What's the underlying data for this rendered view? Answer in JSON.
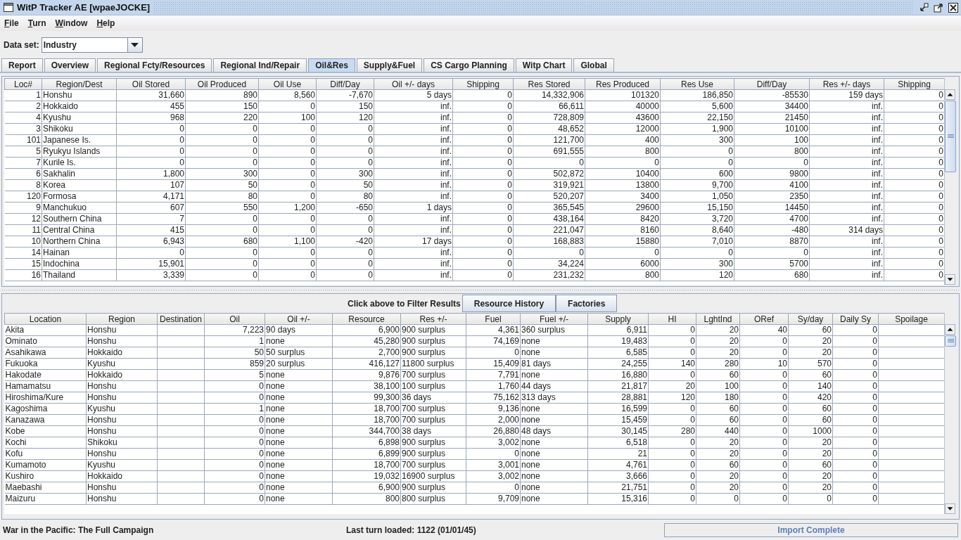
{
  "window": {
    "title": "WitP Tracker AE [wpaeJOCKE]"
  },
  "menu": [
    "File",
    "Turn",
    "Window",
    "Help"
  ],
  "dataset": {
    "label": "Data set:",
    "value": "Industry"
  },
  "tabs": [
    {
      "label": "Report",
      "selected": false
    },
    {
      "label": "Overview",
      "selected": false
    },
    {
      "label": "Regional Fcty/Resources",
      "selected": false
    },
    {
      "label": "Regional Ind/Repair",
      "selected": false
    },
    {
      "label": "Oil&Res",
      "selected": true
    },
    {
      "label": "Supply&Fuel",
      "selected": false
    },
    {
      "label": "CS Cargo Planning",
      "selected": false
    },
    {
      "label": "Witp Chart",
      "selected": false
    },
    {
      "label": "Global",
      "selected": false
    }
  ],
  "oil_res_table": {
    "columns": [
      {
        "label": "Loc#",
        "kind": "number"
      },
      {
        "label": "Region/Dest",
        "kind": "text"
      },
      {
        "label": "Oil Stored",
        "kind": "number"
      },
      {
        "label": "Oil Produced",
        "kind": "number"
      },
      {
        "label": "Oil Use",
        "kind": "number"
      },
      {
        "label": "Diff/Day",
        "kind": "number"
      },
      {
        "label": "Oil +/- days",
        "kind": "number"
      },
      {
        "label": "Shipping",
        "kind": "number"
      },
      {
        "label": "Res Stored",
        "kind": "number"
      },
      {
        "label": "Res Produced",
        "kind": "number"
      },
      {
        "label": "Res Use",
        "kind": "number"
      },
      {
        "label": "Diff/Day",
        "kind": "number"
      },
      {
        "label": "Res +/- days",
        "kind": "number"
      },
      {
        "label": "Shipping",
        "kind": "number"
      }
    ],
    "rows": [
      [
        "1",
        "Honshu",
        "31,660",
        "890",
        "8,560",
        "-7,670",
        "5 days",
        "0",
        "14,332,906",
        "101320",
        "186,850",
        "-85530",
        "159 days",
        "0"
      ],
      [
        "2",
        "Hokkaido",
        "455",
        "150",
        "0",
        "150",
        "inf.",
        "0",
        "66,611",
        "40000",
        "5,600",
        "34400",
        "inf.",
        "0"
      ],
      [
        "4",
        "Kyushu",
        "968",
        "220",
        "100",
        "120",
        "inf.",
        "0",
        "728,809",
        "43600",
        "22,150",
        "21450",
        "inf.",
        "0"
      ],
      [
        "3",
        "Shikoku",
        "0",
        "0",
        "0",
        "0",
        "inf.",
        "0",
        "48,652",
        "12000",
        "1,900",
        "10100",
        "inf.",
        "0"
      ],
      [
        "101",
        "Japanese Is.",
        "0",
        "0",
        "0",
        "0",
        "inf.",
        "0",
        "121,700",
        "400",
        "300",
        "100",
        "inf.",
        "0"
      ],
      [
        "5",
        "Ryukyu Islands",
        "0",
        "0",
        "0",
        "0",
        "inf.",
        "0",
        "691,555",
        "800",
        "0",
        "800",
        "inf.",
        "0"
      ],
      [
        "7",
        "Kurile Is.",
        "0",
        "0",
        "0",
        "0",
        "inf.",
        "0",
        "0",
        "0",
        "0",
        "0",
        "inf.",
        "0"
      ],
      [
        "6",
        "Sakhalin",
        "1,800",
        "300",
        "0",
        "300",
        "inf.",
        "0",
        "502,872",
        "10400",
        "600",
        "9800",
        "inf.",
        "0"
      ],
      [
        "8",
        "Korea",
        "107",
        "50",
        "0",
        "50",
        "inf.",
        "0",
        "319,921",
        "13800",
        "9,700",
        "4100",
        "inf.",
        "0"
      ],
      [
        "120",
        "Formosa",
        "4,171",
        "80",
        "0",
        "80",
        "inf.",
        "0",
        "520,207",
        "3400",
        "1,050",
        "2350",
        "inf.",
        "0"
      ],
      [
        "9",
        "Manchukuo",
        "607",
        "550",
        "1,200",
        "-650",
        "1 days",
        "0",
        "365,545",
        "29600",
        "15,150",
        "14450",
        "inf.",
        "0"
      ],
      [
        "12",
        "Southern China",
        "7",
        "0",
        "0",
        "0",
        "inf.",
        "0",
        "438,164",
        "8420",
        "3,720",
        "4700",
        "inf.",
        "0"
      ],
      [
        "11",
        "Central China",
        "415",
        "0",
        "0",
        "0",
        "inf.",
        "0",
        "221,047",
        "8160",
        "8,640",
        "-480",
        "314 days",
        "0"
      ],
      [
        "10",
        "Northern China",
        "6,943",
        "680",
        "1,100",
        "-420",
        "17 days",
        "0",
        "168,883",
        "15880",
        "7,010",
        "8870",
        "inf.",
        "0"
      ],
      [
        "14",
        "Hainan",
        "0",
        "0",
        "0",
        "0",
        "inf.",
        "0",
        "0",
        "0",
        "0",
        "0",
        "inf.",
        "0"
      ],
      [
        "15",
        "Indochina",
        "15,901",
        "0",
        "0",
        "0",
        "inf.",
        "0",
        "34,224",
        "6000",
        "300",
        "5700",
        "inf.",
        "0"
      ],
      [
        "16",
        "Thailand",
        "3,339",
        "0",
        "0",
        "0",
        "inf.",
        "0",
        "231,232",
        "800",
        "120",
        "680",
        "inf.",
        "0"
      ]
    ]
  },
  "filter_bar": {
    "hint": "Click above to Filter Results",
    "buttons": [
      "Resource History",
      "Factories"
    ]
  },
  "locations_table": {
    "columns": [
      {
        "label": "Location",
        "kind": "text"
      },
      {
        "label": "Region",
        "kind": "text"
      },
      {
        "label": "Destination",
        "kind": "text"
      },
      {
        "label": "Oil",
        "kind": "number"
      },
      {
        "label": "Oil +/-",
        "kind": "text"
      },
      {
        "label": "Resource",
        "kind": "number"
      },
      {
        "label": "Res +/-",
        "kind": "text"
      },
      {
        "label": "Fuel",
        "kind": "number"
      },
      {
        "label": "Fuel +/-",
        "kind": "text"
      },
      {
        "label": "Supply",
        "kind": "number"
      },
      {
        "label": "HI",
        "kind": "number"
      },
      {
        "label": "LghtInd",
        "kind": "number"
      },
      {
        "label": "ORef",
        "kind": "number"
      },
      {
        "label": "Sy/day",
        "kind": "number"
      },
      {
        "label": "Daily Sy",
        "kind": "number"
      },
      {
        "label": "Spoilage",
        "kind": "text"
      }
    ],
    "rows": [
      [
        "Akita",
        "Honshu",
        "",
        "7,223",
        "90 days",
        "6,900",
        "900 surplus",
        "4,361",
        "360 surplus",
        "6,911",
        "0",
        "20",
        "40",
        "60",
        "0",
        ""
      ],
      [
        "Ominato",
        "Honshu",
        "",
        "1",
        "none",
        "45,280",
        "900 surplus",
        "74,169",
        "none",
        "19,483",
        "0",
        "20",
        "0",
        "20",
        "0",
        ""
      ],
      [
        "Asahikawa",
        "Hokkaido",
        "",
        "50",
        "50 surplus",
        "2,700",
        "900 surplus",
        "0",
        "none",
        "6,585",
        "0",
        "20",
        "0",
        "20",
        "0",
        ""
      ],
      [
        "Fukuoka",
        "Kyushu",
        "",
        "859",
        "20 surplus",
        "416,127",
        "11800 surplus",
        "15,409",
        "81 days",
        "24,255",
        "140",
        "280",
        "10",
        "570",
        "0",
        ""
      ],
      [
        "Hakodate",
        "Hokkaido",
        "",
        "5",
        "none",
        "9,876",
        "700 surplus",
        "7,791",
        "none",
        "16,880",
        "0",
        "60",
        "0",
        "60",
        "0",
        ""
      ],
      [
        "Hamamatsu",
        "Honshu",
        "",
        "0",
        "none",
        "38,100",
        "100 surplus",
        "1,760",
        "44 days",
        "21,817",
        "20",
        "100",
        "0",
        "140",
        "0",
        ""
      ],
      [
        "Hiroshima/Kure",
        "Honshu",
        "",
        "0",
        "none",
        "99,300",
        "36 days",
        "75,162",
        "313 days",
        "28,881",
        "120",
        "180",
        "0",
        "420",
        "0",
        ""
      ],
      [
        "Kagoshima",
        "Kyushu",
        "",
        "1",
        "none",
        "18,700",
        "700 surplus",
        "9,136",
        "none",
        "16,599",
        "0",
        "60",
        "0",
        "60",
        "0",
        ""
      ],
      [
        "Kanazawa",
        "Honshu",
        "",
        "0",
        "none",
        "18,700",
        "700 surplus",
        "2,000",
        "none",
        "15,459",
        "0",
        "60",
        "0",
        "60",
        "0",
        ""
      ],
      [
        "Kobe",
        "Honshu",
        "",
        "0",
        "none",
        "344,700",
        "38 days",
        "26,880",
        "48 days",
        "30,145",
        "280",
        "440",
        "0",
        "1000",
        "0",
        ""
      ],
      [
        "Kochi",
        "Shikoku",
        "",
        "0",
        "none",
        "6,898",
        "900 surplus",
        "3,002",
        "none",
        "6,518",
        "0",
        "20",
        "0",
        "20",
        "0",
        ""
      ],
      [
        "Kofu",
        "Honshu",
        "",
        "0",
        "none",
        "6,899",
        "900 surplus",
        "0",
        "none",
        "21",
        "0",
        "20",
        "0",
        "20",
        "0",
        ""
      ],
      [
        "Kumamoto",
        "Kyushu",
        "",
        "0",
        "none",
        "18,700",
        "700 surplus",
        "3,001",
        "none",
        "4,761",
        "0",
        "60",
        "0",
        "60",
        "0",
        ""
      ],
      [
        "Kushiro",
        "Hokkaido",
        "",
        "0",
        "none",
        "19,032",
        "16900 surplus",
        "3,002",
        "none",
        "3,666",
        "0",
        "20",
        "0",
        "20",
        "0",
        ""
      ],
      [
        "Maebashi",
        "Honshu",
        "",
        "0",
        "none",
        "6,900",
        "900 surplus",
        "0",
        "none",
        "21,751",
        "0",
        "20",
        "0",
        "20",
        "0",
        ""
      ],
      [
        "Maizuru",
        "Honshu",
        "",
        "0",
        "none",
        "800",
        "800 surplus",
        "9,709",
        "none",
        "15,316",
        "0",
        "0",
        "0",
        "0",
        "0",
        ""
      ]
    ]
  },
  "status_bar": {
    "campaign": "War in the Pacific: The Full Campaign",
    "last_turn": "Last turn loaded: 1122 (01/01/45)",
    "status": "Import Complete"
  }
}
